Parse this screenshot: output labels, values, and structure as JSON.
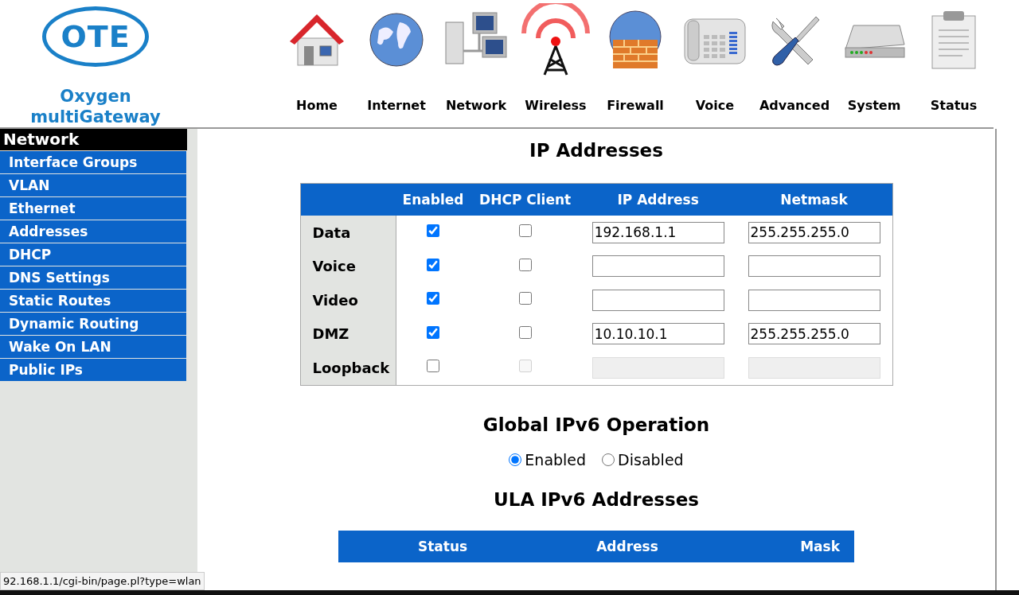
{
  "logo": {
    "brand": "OTE",
    "product_line1": "Oxygen",
    "product_line2": "multiGateway"
  },
  "nav": [
    {
      "label": "Home",
      "kind": "house"
    },
    {
      "label": "Internet",
      "kind": "globe"
    },
    {
      "label": "Network",
      "kind": "computers"
    },
    {
      "label": "Wireless",
      "kind": "tower"
    },
    {
      "label": "Firewall",
      "kind": "firewall"
    },
    {
      "label": "Voice",
      "kind": "phone"
    },
    {
      "label": "Advanced",
      "kind": "tools"
    },
    {
      "label": "System",
      "kind": "modem"
    },
    {
      "label": "Status",
      "kind": "clipboard"
    }
  ],
  "sidebar": {
    "title": "Network",
    "items": [
      {
        "label": "Interface Groups"
      },
      {
        "label": "VLAN"
      },
      {
        "label": "Ethernet"
      },
      {
        "label": "Addresses"
      },
      {
        "label": "DHCP"
      },
      {
        "label": "DNS Settings"
      },
      {
        "label": "Static Routes"
      },
      {
        "label": "Dynamic Routing"
      },
      {
        "label": "Wake On LAN"
      },
      {
        "label": "Public IPs"
      }
    ]
  },
  "ip_addresses": {
    "title": "IP Addresses",
    "columns": [
      "Enabled",
      "DHCP Client",
      "IP Address",
      "Netmask"
    ],
    "rows": [
      {
        "name": "Data",
        "enabled": true,
        "dhcp_client": {
          "checked": false,
          "disabled": false
        },
        "ip": {
          "value": "192.168.1.1",
          "disabled": false
        },
        "netmask": {
          "value": "255.255.255.0",
          "disabled": false
        }
      },
      {
        "name": "Voice",
        "enabled": true,
        "dhcp_client": {
          "checked": false,
          "disabled": false
        },
        "ip": {
          "disabled": false
        },
        "netmask": {
          "disabled": false
        }
      },
      {
        "name": "Video",
        "enabled": true,
        "dhcp_client": {
          "checked": false,
          "disabled": false
        },
        "ip": {
          "disabled": false
        },
        "netmask": {
          "disabled": false
        }
      },
      {
        "name": "DMZ",
        "enabled": true,
        "dhcp_client": {
          "checked": false,
          "disabled": false
        },
        "ip": {
          "value": "10.10.10.1",
          "disabled": false
        },
        "netmask": {
          "value": "255.255.255.0",
          "disabled": false
        }
      },
      {
        "name": "Loopback",
        "enabled": false,
        "dhcp_client": {
          "checked": false,
          "disabled": true
        },
        "ip": {
          "disabled": true
        },
        "netmask": {
          "disabled": true
        }
      }
    ]
  },
  "ipv6": {
    "title": "Global IPv6 Operation",
    "options": [
      {
        "label": "Enabled",
        "selected": true
      },
      {
        "label": "Disabled",
        "selected": false
      }
    ]
  },
  "ula": {
    "title": "ULA IPv6 Addresses",
    "columns": [
      "Status",
      "Address",
      "Mask"
    ]
  },
  "status_url": "92.168.1.1/cgi-bin/page.pl?type=wlan"
}
